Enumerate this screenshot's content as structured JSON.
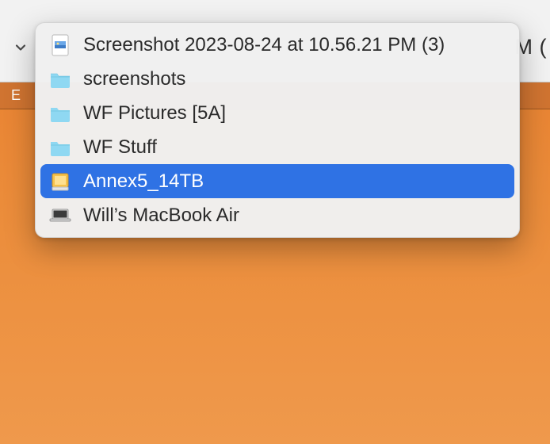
{
  "toolbar": {
    "truncated_text": "M ("
  },
  "secondbar": {
    "letter": "E"
  },
  "dropdown": {
    "items": [
      {
        "label": "Screenshot 2023-08-24 at 10.56.21 PM (3)",
        "icon": "image-file-icon",
        "selected": false
      },
      {
        "label": "screenshots",
        "icon": "folder-icon",
        "selected": false
      },
      {
        "label": "WF Pictures [5A]",
        "icon": "folder-icon",
        "selected": false
      },
      {
        "label": "WF Stuff",
        "icon": "folder-icon",
        "selected": false
      },
      {
        "label": "Annex5_14TB",
        "icon": "external-disk-icon",
        "selected": true
      },
      {
        "label": "Will’s MacBook Air",
        "icon": "laptop-icon",
        "selected": false
      }
    ]
  }
}
